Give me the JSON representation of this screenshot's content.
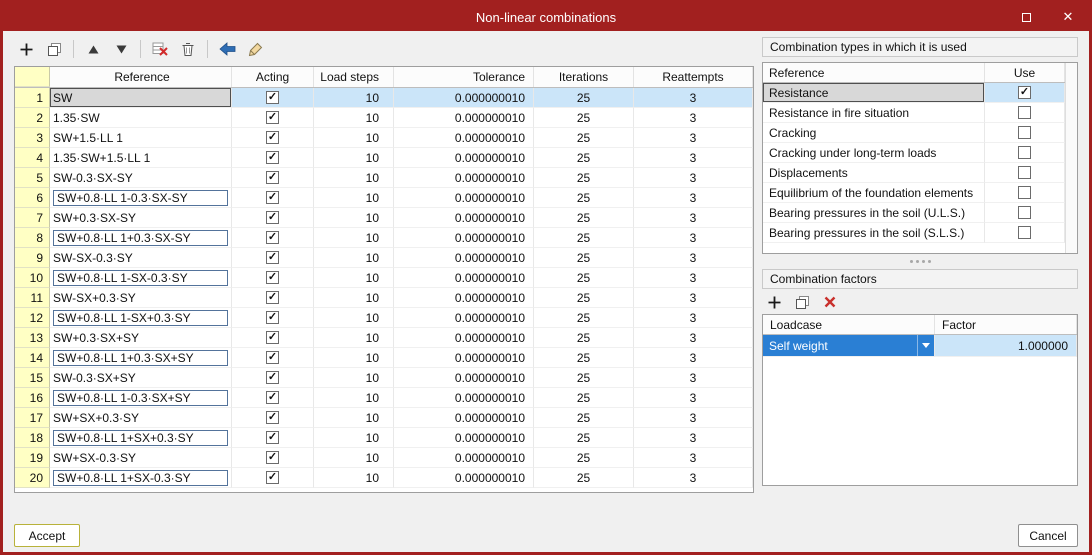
{
  "window": {
    "title": "Non-linear combinations",
    "titlebar_color": "#A2201F"
  },
  "toolbar": {
    "icons": [
      "add",
      "copy",
      "move-up",
      "move-down",
      "delete-rows",
      "delete",
      "undo",
      "clean"
    ]
  },
  "main_table": {
    "columns": [
      "Reference",
      "Acting",
      "Load steps",
      "Tolerance",
      "Iterations",
      "Reattempts"
    ],
    "rows": [
      {
        "num": 1,
        "reference": "SW",
        "acting": true,
        "load_steps": "10",
        "tolerance": "0.000000010",
        "iterations": "25",
        "reattempts": "3",
        "boxed": false,
        "selected": true
      },
      {
        "num": 2,
        "reference": "1.35·SW",
        "acting": true,
        "load_steps": "10",
        "tolerance": "0.000000010",
        "iterations": "25",
        "reattempts": "3",
        "boxed": false,
        "selected": false
      },
      {
        "num": 3,
        "reference": "SW+1.5·LL 1",
        "acting": true,
        "load_steps": "10",
        "tolerance": "0.000000010",
        "iterations": "25",
        "reattempts": "3",
        "boxed": false,
        "selected": false
      },
      {
        "num": 4,
        "reference": "1.35·SW+1.5·LL 1",
        "acting": true,
        "load_steps": "10",
        "tolerance": "0.000000010",
        "iterations": "25",
        "reattempts": "3",
        "boxed": false,
        "selected": false
      },
      {
        "num": 5,
        "reference": "SW-0.3·SX-SY",
        "acting": true,
        "load_steps": "10",
        "tolerance": "0.000000010",
        "iterations": "25",
        "reattempts": "3",
        "boxed": false,
        "selected": false
      },
      {
        "num": 6,
        "reference": "SW+0.8·LL 1-0.3·SX-SY",
        "acting": true,
        "load_steps": "10",
        "tolerance": "0.000000010",
        "iterations": "25",
        "reattempts": "3",
        "boxed": true,
        "selected": false
      },
      {
        "num": 7,
        "reference": "SW+0.3·SX-SY",
        "acting": true,
        "load_steps": "10",
        "tolerance": "0.000000010",
        "iterations": "25",
        "reattempts": "3",
        "boxed": false,
        "selected": false
      },
      {
        "num": 8,
        "reference": "SW+0.8·LL 1+0.3·SX-SY",
        "acting": true,
        "load_steps": "10",
        "tolerance": "0.000000010",
        "iterations": "25",
        "reattempts": "3",
        "boxed": true,
        "selected": false
      },
      {
        "num": 9,
        "reference": "SW-SX-0.3·SY",
        "acting": true,
        "load_steps": "10",
        "tolerance": "0.000000010",
        "iterations": "25",
        "reattempts": "3",
        "boxed": false,
        "selected": false
      },
      {
        "num": 10,
        "reference": "SW+0.8·LL 1-SX-0.3·SY",
        "acting": true,
        "load_steps": "10",
        "tolerance": "0.000000010",
        "iterations": "25",
        "reattempts": "3",
        "boxed": true,
        "selected": false
      },
      {
        "num": 11,
        "reference": "SW-SX+0.3·SY",
        "acting": true,
        "load_steps": "10",
        "tolerance": "0.000000010",
        "iterations": "25",
        "reattempts": "3",
        "boxed": false,
        "selected": false
      },
      {
        "num": 12,
        "reference": "SW+0.8·LL 1-SX+0.3·SY",
        "acting": true,
        "load_steps": "10",
        "tolerance": "0.000000010",
        "iterations": "25",
        "reattempts": "3",
        "boxed": true,
        "selected": false
      },
      {
        "num": 13,
        "reference": "SW+0.3·SX+SY",
        "acting": true,
        "load_steps": "10",
        "tolerance": "0.000000010",
        "iterations": "25",
        "reattempts": "3",
        "boxed": false,
        "selected": false
      },
      {
        "num": 14,
        "reference": "SW+0.8·LL 1+0.3·SX+SY",
        "acting": true,
        "load_steps": "10",
        "tolerance": "0.000000010",
        "iterations": "25",
        "reattempts": "3",
        "boxed": true,
        "selected": false
      },
      {
        "num": 15,
        "reference": "SW-0.3·SX+SY",
        "acting": true,
        "load_steps": "10",
        "tolerance": "0.000000010",
        "iterations": "25",
        "reattempts": "3",
        "boxed": false,
        "selected": false
      },
      {
        "num": 16,
        "reference": "SW+0.8·LL 1-0.3·SX+SY",
        "acting": true,
        "load_steps": "10",
        "tolerance": "0.000000010",
        "iterations": "25",
        "reattempts": "3",
        "boxed": true,
        "selected": false
      },
      {
        "num": 17,
        "reference": "SW+SX+0.3·SY",
        "acting": true,
        "load_steps": "10",
        "tolerance": "0.000000010",
        "iterations": "25",
        "reattempts": "3",
        "boxed": false,
        "selected": false
      },
      {
        "num": 18,
        "reference": "SW+0.8·LL 1+SX+0.3·SY",
        "acting": true,
        "load_steps": "10",
        "tolerance": "0.000000010",
        "iterations": "25",
        "reattempts": "3",
        "boxed": true,
        "selected": false
      },
      {
        "num": 19,
        "reference": "SW+SX-0.3·SY",
        "acting": true,
        "load_steps": "10",
        "tolerance": "0.000000010",
        "iterations": "25",
        "reattempts": "3",
        "boxed": false,
        "selected": false
      },
      {
        "num": 20,
        "reference": "SW+0.8·LL 1+SX-0.3·SY",
        "acting": true,
        "load_steps": "10",
        "tolerance": "0.000000010",
        "iterations": "25",
        "reattempts": "3",
        "boxed": true,
        "selected": false
      }
    ]
  },
  "combination_types": {
    "title": "Combination types in which it is used",
    "columns": [
      "Reference",
      "Use"
    ],
    "rows": [
      {
        "label": "Resistance",
        "use": true,
        "selected": true
      },
      {
        "label": "Resistance in fire situation",
        "use": false,
        "selected": false
      },
      {
        "label": "Cracking",
        "use": false,
        "selected": false
      },
      {
        "label": "Cracking under long-term loads",
        "use": false,
        "selected": false
      },
      {
        "label": "Displacements",
        "use": false,
        "selected": false
      },
      {
        "label": "Equilibrium of the foundation elements",
        "use": false,
        "selected": false
      },
      {
        "label": "Bearing pressures in the soil (U.L.S.)",
        "use": false,
        "selected": false
      },
      {
        "label": "Bearing pressures in the soil (S.L.S.)",
        "use": false,
        "selected": false
      }
    ]
  },
  "combination_factors": {
    "title": "Combination factors",
    "toolbar_icons": [
      "add",
      "copy",
      "delete"
    ],
    "columns": [
      "Loadcase",
      "Factor"
    ],
    "rows": [
      {
        "loadcase": "Self weight",
        "factor": "1.000000"
      }
    ]
  },
  "buttons": {
    "accept": "Accept",
    "cancel": "Cancel"
  }
}
